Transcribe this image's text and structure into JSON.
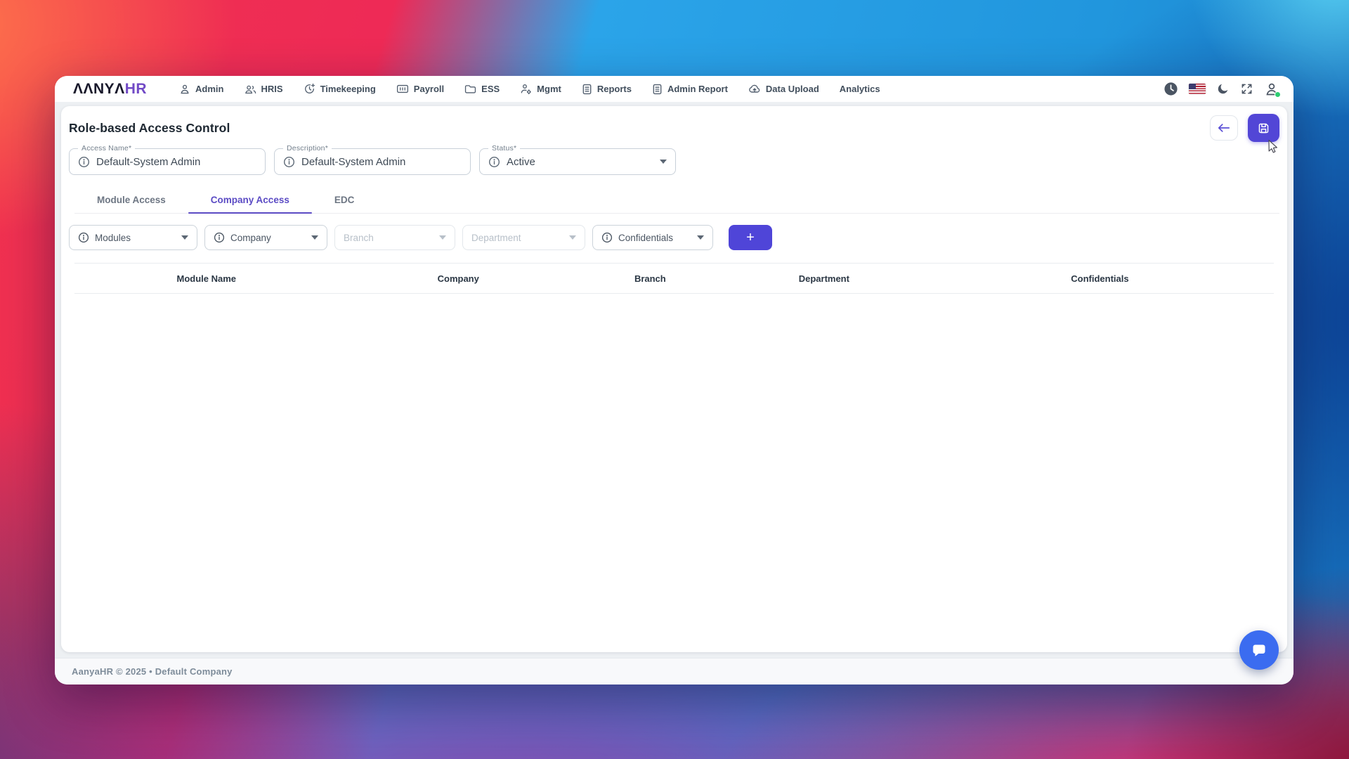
{
  "nav": {
    "logo_primary": "ΛΛNYΛ",
    "logo_accent": "HR",
    "items": [
      {
        "label": "Admin",
        "icon": "person-icon"
      },
      {
        "label": "HRIS",
        "icon": "people-icon"
      },
      {
        "label": "Timekeeping",
        "icon": "clock-plus-icon"
      },
      {
        "label": "Payroll",
        "icon": "banknote-icon"
      },
      {
        "label": "ESS",
        "icon": "folder-icon"
      },
      {
        "label": "Mgmt",
        "icon": "person-gear-icon"
      },
      {
        "label": "Reports",
        "icon": "document-icon"
      },
      {
        "label": "Admin Report",
        "icon": "document-icon"
      },
      {
        "label": "Data Upload",
        "icon": "cloud-upload-icon"
      },
      {
        "label": "Analytics",
        "icon": "none"
      }
    ]
  },
  "page": {
    "title": "Role-based Access Control",
    "fields": {
      "access_name": {
        "label": "Access Name*",
        "value": "Default-System Admin"
      },
      "description": {
        "label": "Description*",
        "value": "Default-System Admin"
      },
      "status": {
        "label": "Status*",
        "value": "Active"
      }
    },
    "tabs": [
      {
        "label": "Module Access",
        "active": false
      },
      {
        "label": "Company Access",
        "active": true
      },
      {
        "label": "EDC",
        "active": false
      }
    ],
    "filters": [
      {
        "label": "Modules",
        "disabled": false
      },
      {
        "label": "Company",
        "disabled": false
      },
      {
        "label": "Branch",
        "disabled": true
      },
      {
        "label": "Department",
        "disabled": true
      },
      {
        "label": "Confidentials",
        "disabled": false
      }
    ],
    "add_button_label": "+",
    "table": {
      "columns": [
        "Module Name",
        "Company",
        "Branch",
        "Department",
        "Confidentials"
      ],
      "rows": []
    }
  },
  "footer": {
    "text": "AanyaHR © 2025 • Default Company"
  },
  "colors": {
    "accent": "#5246d6",
    "tab_active": "#5b4bc4",
    "chat_fab": "#3b6cf0",
    "online_dot": "#2ecc71"
  }
}
